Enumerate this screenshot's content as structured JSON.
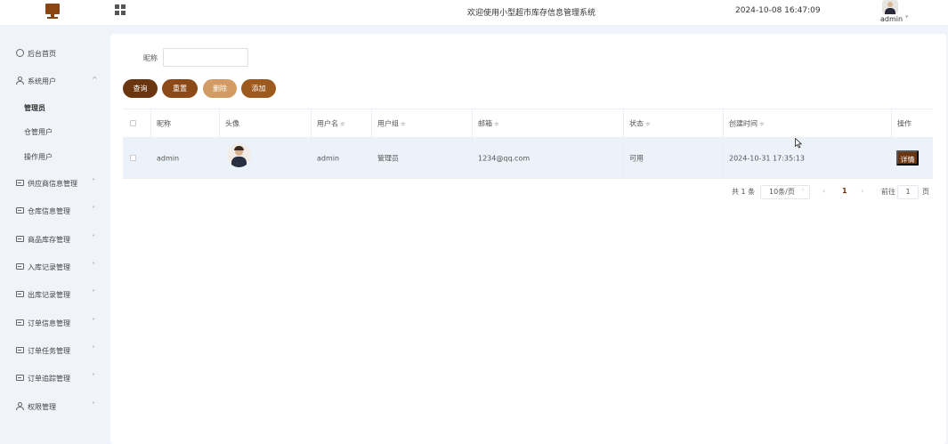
{
  "header": {
    "welcome": "欢迎使用小型超市库存信息管理系统",
    "datetime": "2024-10-08 16:47:09",
    "user": "admin",
    "user_caret": "˅"
  },
  "sidebar": {
    "items": [
      {
        "label": "后台首页",
        "icon": "clock-icon"
      },
      {
        "label": "系统用户",
        "icon": "user-icon",
        "chevron": "^"
      },
      {
        "label": "管理员",
        "sub": true,
        "active": true
      },
      {
        "label": "仓管用户",
        "sub": true
      },
      {
        "label": "操作用户",
        "sub": true
      },
      {
        "label": "供应商信息管理",
        "icon": "card-icon",
        "chevron": "˅"
      },
      {
        "label": "仓库信息管理",
        "icon": "card-icon",
        "chevron": "˅"
      },
      {
        "label": "商品库存管理",
        "icon": "card-icon",
        "chevron": "˅"
      },
      {
        "label": "入库记录管理",
        "icon": "card-icon",
        "chevron": "˅"
      },
      {
        "label": "出库记录管理",
        "icon": "card-icon",
        "chevron": "˅"
      },
      {
        "label": "订单信息管理",
        "icon": "card-icon",
        "chevron": "˅"
      },
      {
        "label": "订单任务管理",
        "icon": "card-icon",
        "chevron": "˅"
      },
      {
        "label": "订单追踪管理",
        "icon": "card-icon",
        "chevron": "˅"
      },
      {
        "label": "权限管理",
        "icon": "user-icon",
        "chevron": "˅"
      }
    ]
  },
  "search": {
    "label": "昵称",
    "value": "",
    "placeholder": ""
  },
  "buttons": {
    "search": "查询",
    "reset": "重置",
    "delete": "删除",
    "add": "添加"
  },
  "table": {
    "columns": [
      "昵称",
      "头像",
      "用户名",
      "用户组",
      "邮箱",
      "状态",
      "创建时间",
      "操作"
    ],
    "sortable_mark": "≑",
    "rows": [
      {
        "nickname": "admin",
        "username": "admin",
        "group": "管理员",
        "email": "1234@qq.com",
        "status": "可用",
        "created": "2024-10-31 17:35:13",
        "action": "详情"
      }
    ]
  },
  "pagination": {
    "total": "共 1 条",
    "page_size": "10条/页",
    "size_caret": "˅",
    "prev": "‹",
    "current": "1",
    "next": "›",
    "goto_label": "前往",
    "goto_value": "1",
    "page_suffix": "页"
  },
  "colors": {
    "primary": "#6b3510",
    "secondary": "#8b4a17",
    "delete": "#d39b64",
    "add": "#9c5a1e",
    "row_highlight": "#ecf2fa"
  }
}
